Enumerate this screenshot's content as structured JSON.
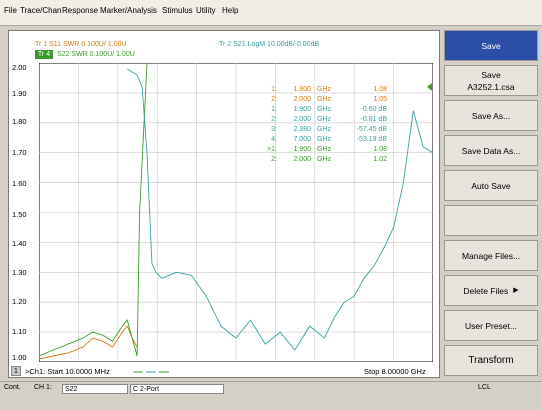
{
  "menu": [
    "File",
    "Trace/Chan",
    "Response",
    "Marker/Analysis",
    "Stimulus",
    "Utility",
    "Help"
  ],
  "traces": {
    "tr1": "Tr 1  S11 SWR 0.100U/  1.00U",
    "tr4_label": "Tr 4",
    "tr4": "S22 SWR 0.100U/  1.00U",
    "tr2": "Tr 2  S21 LogM 10.00dB/  0.00dB"
  },
  "y_ticks": [
    "2.00",
    "1.90",
    "1.80",
    "1.70",
    "1.60",
    "1.50",
    "1.40",
    "1.30",
    "1.20",
    "1.10",
    "1.00"
  ],
  "markers": [
    {
      "id": "1:",
      "freq": "1.900",
      "unit": "GHz",
      "value": "1.08",
      "color": "#d47a10"
    },
    {
      "id": "2:",
      "freq": "2.000",
      "unit": "GHz",
      "value": "1.05",
      "color": "#d47a10"
    },
    {
      "id": "1:",
      "freq": "1.900",
      "unit": "GHz",
      "value": "-0.60 dB",
      "color": "#3aa0a0"
    },
    {
      "id": "2:",
      "freq": "2.000",
      "unit": "GHz",
      "value": "-0.81 dB",
      "color": "#3aa0a0"
    },
    {
      "id": "3:",
      "freq": "2.380",
      "unit": "GHz",
      "value": "-57.45 dB",
      "color": "#3aa0a0"
    },
    {
      "id": "4:",
      "freq": "7.000",
      "unit": "GHz",
      "value": "-53.19 dB",
      "color": "#3aa0a0"
    },
    {
      "id": ">1:",
      "freq": "1.900",
      "unit": "GHz",
      "value": "1.08",
      "color": "#3c9a2c"
    },
    {
      "id": "2:",
      "freq": "2.000",
      "unit": "GHz",
      "value": "1.02",
      "color": "#3c9a2c"
    }
  ],
  "footer": {
    "ch_box": "1",
    "start": ">Ch1: Start  10.0000 MHz",
    "stop": "Stop  8.00000 GHz"
  },
  "softkeys": {
    "save": "Save",
    "save_file_title": "Save",
    "save_file_name": "A3252.1.csa",
    "save_as": "Save As...",
    "save_data_as": "Save Data As...",
    "auto_save": "Auto Save",
    "blank": "",
    "manage_files": "Manage Files...",
    "delete_files": "Delete Files",
    "user_preset": "User Preset...",
    "transform": "Transform"
  },
  "status": {
    "cont": "Cont.",
    "ch": "CH 1:",
    "param": "S22",
    "port": "C  2-Port",
    "lcl": "LCL"
  },
  "colors": {
    "s11": "#d47a10",
    "s21": "#3aa0a0",
    "s22": "#3c9a2c",
    "accent": "#2c4ea8"
  },
  "chart_data": {
    "type": "line",
    "x_range_ghz": [
      0.01,
      8.0
    ],
    "ylim": [
      1.0,
      2.0
    ],
    "grid": true,
    "series": [
      {
        "name": "S11",
        "color": "#d47a10",
        "x": [
          0.01,
          0.3,
          0.6,
          0.9,
          1.1,
          1.3,
          1.5,
          1.7,
          1.8,
          1.9,
          2.0
        ],
        "y": [
          1.01,
          1.02,
          1.03,
          1.05,
          1.08,
          1.07,
          1.05,
          1.1,
          1.12,
          1.08,
          1.05
        ]
      },
      {
        "name": "S22",
        "color": "#3c9a2c",
        "x": [
          0.01,
          0.3,
          0.6,
          0.9,
          1.1,
          1.3,
          1.5,
          1.7,
          1.8,
          1.9,
          2.0,
          2.05,
          2.2
        ],
        "y": [
          1.02,
          1.04,
          1.06,
          1.08,
          1.1,
          1.09,
          1.07,
          1.12,
          1.14,
          1.08,
          1.02,
          1.5,
          2.0
        ]
      },
      {
        "name": "S21",
        "color": "#3aa0a0",
        "x": [
          1.8,
          1.9,
          2.0,
          2.1,
          2.2,
          2.3,
          2.38,
          2.5,
          2.8,
          3.1,
          3.4,
          3.7,
          4.0,
          4.3,
          4.6,
          4.9,
          5.2,
          5.5,
          5.8,
          6.0,
          6.2,
          6.4,
          6.6,
          6.8,
          7.0,
          7.2,
          7.4,
          7.6,
          7.8,
          8.0
        ],
        "y": [
          1.98,
          1.97,
          1.96,
          1.92,
          1.7,
          1.33,
          1.3,
          1.28,
          1.3,
          1.29,
          1.22,
          1.12,
          1.08,
          1.14,
          1.06,
          1.1,
          1.04,
          1.12,
          1.08,
          1.15,
          1.2,
          1.22,
          1.28,
          1.32,
          1.38,
          1.45,
          1.6,
          1.84,
          1.72,
          1.7
        ]
      }
    ]
  }
}
